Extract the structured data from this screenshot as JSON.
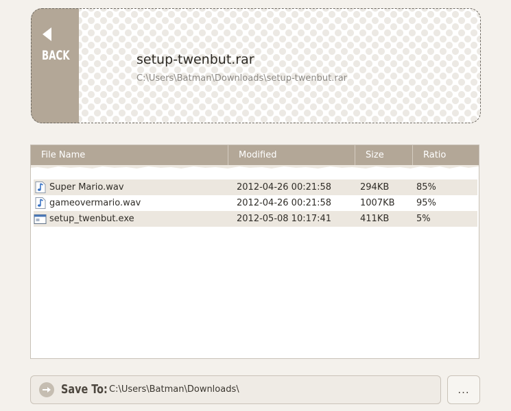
{
  "header": {
    "back_label": "BACK",
    "file_title": "setup-twenbut.rar",
    "file_path": "C:\\Users\\Batman\\Downloads\\setup-twenbut.rar"
  },
  "list": {
    "columns": {
      "name": "File Name",
      "modified": "Modified",
      "size": "Size",
      "ratio": "Ratio"
    },
    "rows": [
      {
        "icon": "audio-file-icon",
        "name": "Super Mario.wav",
        "modified": "2012-04-26 00:21:58",
        "size": "294KB",
        "ratio": "85%"
      },
      {
        "icon": "audio-file-icon",
        "name": "gameovermario.wav",
        "modified": "2012-04-26 00:21:58",
        "size": "1007KB",
        "ratio": "95%"
      },
      {
        "icon": "executable-file-icon",
        "name": "setup_twenbut.exe",
        "modified": "2012-05-08 10:17:41",
        "size": "411KB",
        "ratio": "5%"
      }
    ]
  },
  "save": {
    "label": "Save To:",
    "path": "C:\\Users\\Batman\\Downloads\\",
    "browse_label": "..."
  },
  "colors": {
    "accent": "#b3a797",
    "background": "#f4f1ec",
    "row_alt": "#ece7df"
  }
}
